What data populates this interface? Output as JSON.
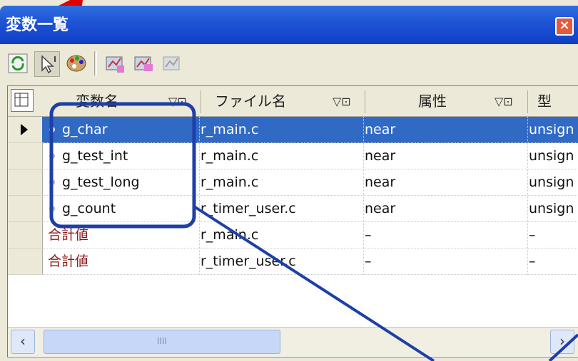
{
  "window": {
    "title": "変数一覧",
    "close_icon": "close-icon"
  },
  "toolbar": {
    "buttons": [
      "refresh-icon",
      "pointer-icon",
      "palette-icon",
      "chart-icon-1",
      "chart-icon-2",
      "chart-icon-3"
    ]
  },
  "table": {
    "columns": [
      {
        "label": "変数名"
      },
      {
        "label": "ファイル名"
      },
      {
        "label": "属性"
      },
      {
        "label": "型"
      }
    ],
    "rows": [
      {
        "name": "g_char",
        "file": "r_main.c",
        "attr": "near",
        "type": "unsign",
        "selected": true
      },
      {
        "name": "g_test_int",
        "file": "r_main.c",
        "attr": "near",
        "type": "unsign"
      },
      {
        "name": "g_test_long",
        "file": "r_main.c",
        "attr": "near",
        "type": "unsign"
      },
      {
        "name": "g_count",
        "file": "r_timer_user.c",
        "attr": "near",
        "type": "unsign"
      },
      {
        "name": "合計値",
        "file": "r_main.c",
        "attr": "–",
        "type": "–",
        "total": true
      },
      {
        "name": "合計値",
        "file": "r_timer_user.c",
        "attr": "–",
        "type": "–",
        "total": true
      }
    ]
  },
  "scrollbar": {
    "thumb_grip": "IIII"
  },
  "colors": {
    "selection": "#316AC5",
    "total_text": "#8b1a1a",
    "annotation": "#1e3fa8",
    "pointer": "#ff0000"
  }
}
